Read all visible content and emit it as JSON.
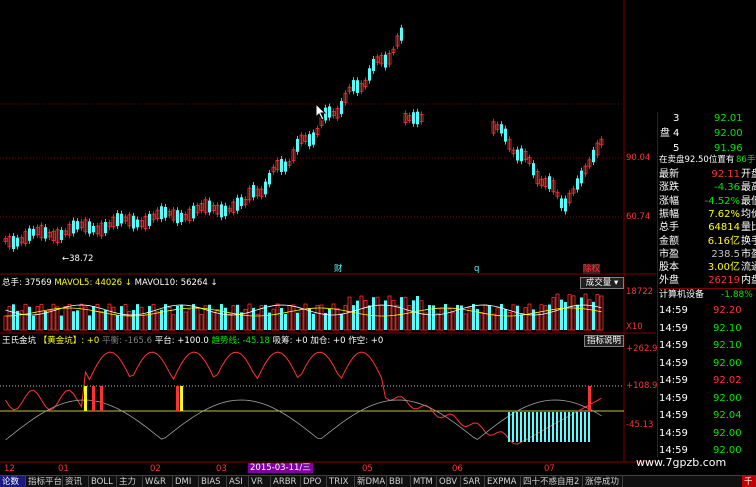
{
  "price_axis": {
    "upper": "90.04",
    "lower": "60.74"
  },
  "event_marks": [
    {
      "text": "财",
      "color": "#54ffff"
    },
    {
      "text": "q",
      "color": "#54ffff"
    },
    {
      "text": "除权",
      "color": "#ff3232"
    }
  ],
  "prev_price_low": "38.72",
  "volume_bar": {
    "total_label": "总手",
    "total_value": "37569",
    "ma5_label": "MAVOL5",
    "ma5_value": "44026",
    "ma10_label": "MAVOL10",
    "ma10_value": "56264",
    "dropdown": "成交量",
    "axis_top": "18722",
    "axis_bottom": "X10"
  },
  "indicator_bar": {
    "name": "王氏金坑",
    "sub": "【黄金坑】: +0",
    "pingheng": "平衡: -165.6",
    "pingtai": "平台: +100.0",
    "trend": "趋势线: -45.18",
    "xichou": "吸筹: +0",
    "jiacang": "加仓: +0",
    "zuokong": "作空: +0",
    "button": "指标说明",
    "axis": [
      "+262.9",
      "+108.9",
      "-45.13"
    ]
  },
  "date_axis": [
    "12",
    "01",
    "02",
    "03",
    "2015-03-11/三",
    "05",
    "06",
    "07"
  ],
  "quote_top": [
    {
      "label": "3",
      "price": "92.01",
      "vol": ""
    },
    {
      "label": "4",
      "price": "92.00",
      "vol": ""
    },
    {
      "label": "5",
      "price": "91.96",
      "vol": ""
    }
  ],
  "quote_side_char": "盘",
  "entrust": {
    "text": "在卖盘92.50位置有",
    "vol": "86手"
  },
  "stats": [
    {
      "l1": "最新",
      "v1": "92.11",
      "l2": "开盘",
      "c": "#ff3232"
    },
    {
      "l1": "涨跌",
      "v1": "-4.36",
      "l2": "最高",
      "c": "#00e600"
    },
    {
      "l1": "涨幅",
      "v1": "-4.52%",
      "l2": "最低",
      "c": "#00e600"
    },
    {
      "l1": "振幅",
      "v1": "7.62%",
      "l2": "均价",
      "c": "#ffff00"
    },
    {
      "l1": "总手",
      "v1": "64814",
      "l2": "量比",
      "c": "#ffff00"
    },
    {
      "l1": "金额",
      "v1": "6.16亿",
      "l2": "换手",
      "c": "#ffff00"
    },
    {
      "l1": "市盈",
      "v1": "238.5",
      "l2": "市盈",
      "c": "#c0c0c0"
    },
    {
      "l1": "股本",
      "v1": "3.00亿",
      "l2": "流通",
      "c": "#ffff00"
    },
    {
      "l1": "外盘",
      "v1": "26219",
      "l2": "内盘",
      "c": "#ff3232"
    }
  ],
  "sector": {
    "name": "计算机设备",
    "change": "-1.88%"
  },
  "ticks": [
    {
      "t": "14:59",
      "p": "92.20"
    },
    {
      "t": "14:59",
      "p": "92.10"
    },
    {
      "t": "14:59",
      "p": "92.10"
    },
    {
      "t": "14:59",
      "p": "92.00"
    },
    {
      "t": "14:59",
      "p": "92.02"
    },
    {
      "t": "14:59",
      "p": "92.00"
    },
    {
      "t": "14:59",
      "p": "92.04"
    },
    {
      "t": "14:59",
      "p": "92.00"
    },
    {
      "t": "14:59",
      "p": "92.00"
    }
  ],
  "watermark": "www.7gpzb.com",
  "tabs": [
    "论数",
    "指标平台",
    "资讯",
    "BOLL",
    "主力",
    "W&R",
    "DMI",
    "BIAS",
    "ASI",
    "VR",
    "ARBR",
    "DPO",
    "TRIX",
    "新DMA",
    "BBI",
    "MTM",
    "OBV",
    "SAR",
    "EXPMA",
    "四十不惑自用2",
    "涨停成功"
  ],
  "colors": {
    "up": "#ff3232",
    "down": "#54ffff",
    "bg": "#000000",
    "grid": "#800000"
  }
}
